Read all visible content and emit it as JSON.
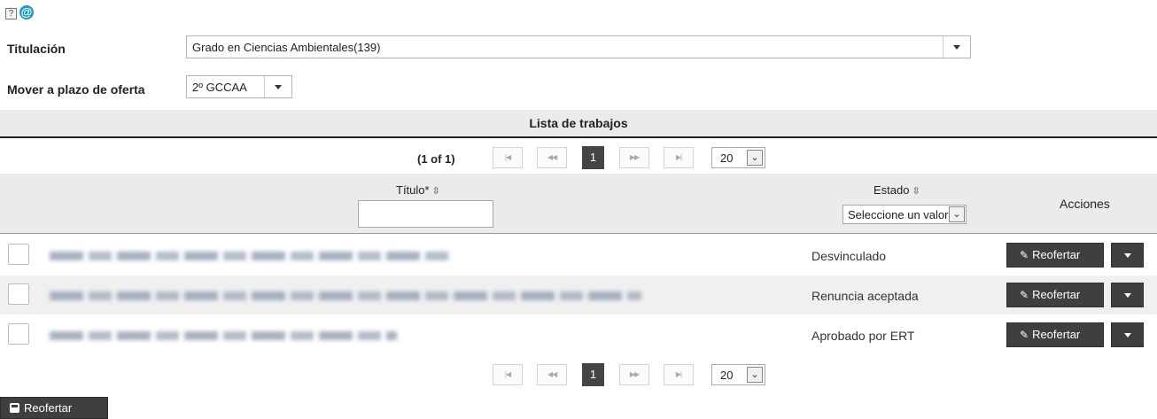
{
  "top_icons": {
    "help_glyph": "?",
    "at_glyph": "@"
  },
  "form": {
    "titulacion_label": "Titulación",
    "titulacion_value": "Grado en Ciencias Ambientales(139)",
    "mover_label": "Mover a plazo de oferta",
    "mover_value": "2º GCCAA"
  },
  "list": {
    "header": "Lista de trabajos",
    "pager_count": "(1 of 1)",
    "first_glyph": "|◀",
    "prev_glyph": "◀◀",
    "current_page": "1",
    "next_glyph": "▶▶",
    "last_glyph": "▶|",
    "rows_per_page": "20",
    "chevron_glyph": "⌄",
    "columns": {
      "titulo": "Título*",
      "estado": "Estado",
      "acciones": "Acciones",
      "sort_glyph": "⇳",
      "estado_filter_value": "Seleccione un valor"
    },
    "rows": [
      {
        "estado": "Desvinculado",
        "action": "Reofertar"
      },
      {
        "estado": "Renuncia aceptada",
        "action": "Reofertar"
      },
      {
        "estado": "Aprobado por ERT",
        "action": "Reofertar"
      }
    ]
  },
  "footer": {
    "reofertar_label": "Reofertar"
  },
  "icons": [
    "help-icon",
    "at-icon",
    "sort-icon",
    "pencil-icon",
    "save-icon",
    "chevron-down-icon"
  ]
}
